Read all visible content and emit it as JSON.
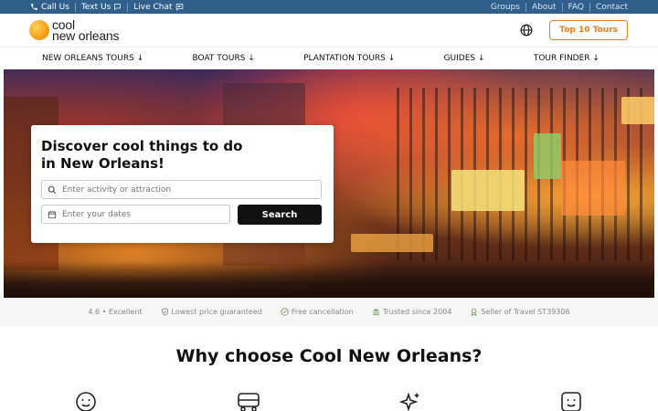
{
  "topbar": {
    "call_us": "Call Us",
    "text_us": "Text Us",
    "live_chat": "Live Chat",
    "links": [
      "Groups",
      "About",
      "FAQ",
      "Contact"
    ]
  },
  "header": {
    "logo_line1": "cool",
    "logo_line2": "new orleans",
    "top10_label": "Top 10 Tours",
    "accent_color": "#f07c1b",
    "topbar_color": "#2f5f8a"
  },
  "nav": {
    "items": [
      "NEW ORLEANS TOURS ↓",
      "BOAT TOURS ↓",
      "PLANTATION TOURS ↓",
      "GUIDES ↓",
      "TOUR FINDER ↓"
    ]
  },
  "hero": {
    "heading_line1": "Discover cool things to do",
    "heading_line2": "in New Orleans!",
    "activity_placeholder": "Enter activity or attraction",
    "dates_placeholder": "Enter your dates",
    "search_label": "Search"
  },
  "trust": {
    "rating": "4.6 • Excellent",
    "lowest_price": "Lowest price guaranteed",
    "free_cancel": "Free cancellation",
    "trusted": "Trusted since 2004",
    "seller": "Seller of Travel ST39306"
  },
  "why": {
    "title": "Why choose Cool New Orleans?",
    "icons": [
      "smile-icon",
      "bus-icon",
      "sparkle-icon",
      "happy-face-icon"
    ]
  }
}
